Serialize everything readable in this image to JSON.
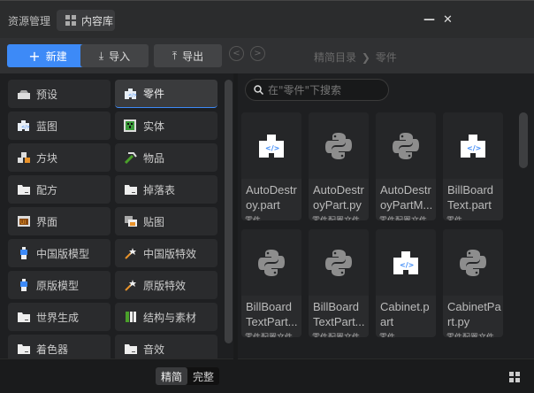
{
  "title": "资源管理",
  "tab": "内容库",
  "toolbar": {
    "new": "新建",
    "import": "导入",
    "export": "导出"
  },
  "breadcrumb": {
    "root": "精简目录",
    "sep": "❯",
    "current": "零件"
  },
  "categories": [
    {
      "label": "预设",
      "icon": "preset-icon"
    },
    {
      "label": "零件",
      "icon": "puzzle-icon",
      "active": true
    },
    {
      "label": "蓝图",
      "icon": "puzzle-icon"
    },
    {
      "label": "实体",
      "icon": "creeper-icon"
    },
    {
      "label": "方块",
      "icon": "blocks-icon"
    },
    {
      "label": "物品",
      "icon": "pickaxe-icon"
    },
    {
      "label": "配方",
      "icon": "folder-icon"
    },
    {
      "label": "掉落表",
      "icon": "folder-icon"
    },
    {
      "label": "界面",
      "icon": "ui-icon"
    },
    {
      "label": "贴图",
      "icon": "image-icon"
    },
    {
      "label": "中国版模型",
      "icon": "model-icon"
    },
    {
      "label": "中国版特效",
      "icon": "wand-icon"
    },
    {
      "label": "原版模型",
      "icon": "model-icon"
    },
    {
      "label": "原版特效",
      "icon": "wand-icon"
    },
    {
      "label": "世界生成",
      "icon": "folder-icon"
    },
    {
      "label": "结构与素材",
      "icon": "structure-icon"
    },
    {
      "label": "着色器",
      "icon": "folder-icon"
    },
    {
      "label": "音效",
      "icon": "folder-icon"
    }
  ],
  "view_toggle": {
    "simple": "精简",
    "full": "完整"
  },
  "search": {
    "placeholder": "在\"零件\"下搜索"
  },
  "files": [
    {
      "name": "AutoDestroy.part",
      "display": "AutoDestr oy.part",
      "type": "零件",
      "kind": "part"
    },
    {
      "name": "AutoDestroyPart.py",
      "display": "AutoDestr oyPart.py",
      "type": "零件配置文件",
      "kind": "py"
    },
    {
      "name": "AutoDestroyPartM...",
      "display": "AutoDestr oyPartM...",
      "type": "零件配置文件",
      "kind": "py"
    },
    {
      "name": "BillBoardText.part",
      "display": "BillBoard Text.part",
      "type": "零件",
      "kind": "part"
    },
    {
      "name": "BillBoardTextPart...",
      "display": "BillBoard TextPart...",
      "type": "零件配置文件",
      "kind": "py"
    },
    {
      "name": "BillBoardTextPart...",
      "display": "BillBoard TextPart...",
      "type": "零件配置文件",
      "kind": "py"
    },
    {
      "name": "Cabinet.part",
      "display": "Cabinet.p art",
      "type": "零件",
      "kind": "part"
    },
    {
      "name": "CabinetPart.py",
      "display": "CabinetPa rt.py",
      "type": "零件配置文件",
      "kind": "py"
    }
  ],
  "colors": {
    "accent": "#3d8af7",
    "bg": "#1e1f21"
  }
}
